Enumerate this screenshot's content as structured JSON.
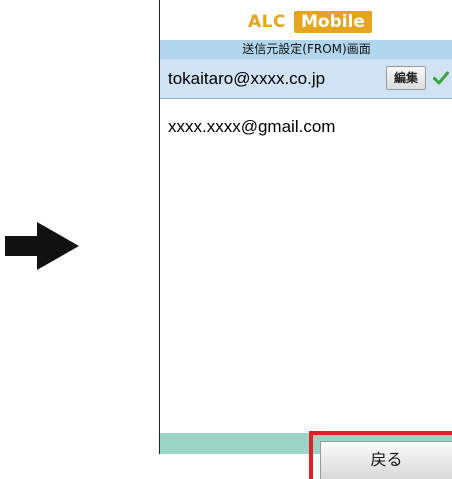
{
  "logo": {
    "part1": "ALC",
    "part2": "Mobile"
  },
  "screen": {
    "title": "送信元設定(FROM)画面"
  },
  "accounts": [
    {
      "email": "tokaitaro@xxxx.co.jp",
      "selected": true,
      "edit_label": "編集",
      "status_icon": "check-icon"
    },
    {
      "email": "xxxx.xxxx@gmail.com",
      "selected": false
    }
  ],
  "footer": {
    "back_label": "戻る"
  },
  "colors": {
    "brand": "#e7a41d",
    "title_bar": "#b2d5ee",
    "selected_row": "#cfe3f4",
    "footer": "#9bd6c4",
    "highlight": "#e12127",
    "check": "#3aa53a"
  },
  "annotation": {
    "left_arrow_icon": "right-arrow-icon"
  }
}
